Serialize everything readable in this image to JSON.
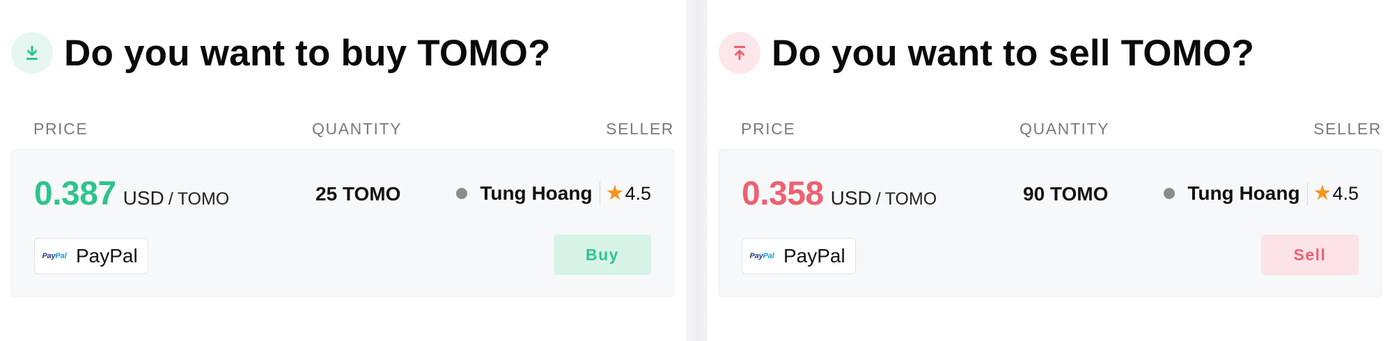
{
  "buy_panel": {
    "icon": "download-icon",
    "title": "Do you want to buy TOMO?",
    "columns": {
      "price": "PRICE",
      "quantity": "QUANTITY",
      "seller": "SELLER"
    },
    "offer": {
      "price": "0.387",
      "currency": "USD",
      "separator": "/",
      "coin": "TOMO",
      "quantity": "25 TOMO",
      "seller_name": "Tung Hoang",
      "rating": "4.5",
      "payment_method": "PayPal",
      "payment_logo_a": "Pay",
      "payment_logo_b": "Pal",
      "action_label": "Buy"
    },
    "accent": "#2ec48d"
  },
  "sell_panel": {
    "icon": "upload-icon",
    "title": "Do you want to sell TOMO?",
    "columns": {
      "price": "PRICE",
      "quantity": "QUANTITY",
      "seller": "SELLER"
    },
    "offer": {
      "price": "0.358",
      "currency": "USD",
      "separator": "/",
      "coin": "TOMO",
      "quantity": "90 TOMO",
      "seller_name": "Tung Hoang",
      "rating": "4.5",
      "payment_method": "PayPal",
      "payment_logo_a": "Pay",
      "payment_logo_b": "Pal",
      "action_label": "Sell"
    },
    "accent": "#ee6070"
  },
  "star_color": "#f7931e",
  "status_dot_color": "#8b8b8b"
}
